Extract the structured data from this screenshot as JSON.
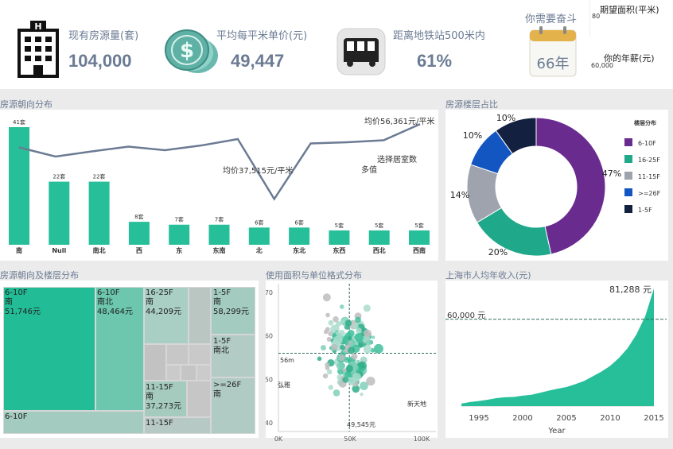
{
  "kpis": {
    "stock_label": "现有房源量(套)",
    "stock_value": "104,000",
    "price_label": "平均每平米单价(元)",
    "price_value": "49,447",
    "metro_label": "距离地铁站500米内",
    "metro_value": "61%",
    "work_label": "你需要奋斗",
    "work_value": "66年",
    "desired_area_label": "期望面积(平米)",
    "desired_area_value": "80",
    "salary_label": "你的年薪(元)",
    "salary_value": "60,000"
  },
  "colors": {
    "teal": "#26bf99",
    "line": "#6b7b93",
    "purple": "#6a2b8f",
    "green2": "#1fa88a",
    "gray": "#9ea3ad",
    "blue": "#1356c2",
    "navy": "#14203f"
  },
  "orientation": {
    "title": "房源朝向分布",
    "annot_high": "均价56,361元/平米",
    "annot_low": "均价37,515元/平米",
    "annot_mid1": "选择居室数",
    "annot_mid2": "多值"
  },
  "floor": {
    "title": "房源楼层占比",
    "legend_title": "楼层分布"
  },
  "treemap": {
    "title": "房源朝向及楼层分布",
    "cells": [
      {
        "floor": "6-10F",
        "dir": "南",
        "price": "51,746元"
      },
      {
        "floor": "6-10F",
        "dir": "南北",
        "price": "48,464元"
      },
      {
        "floor": "16-25F",
        "dir": "南",
        "price": "44,209元"
      },
      {
        "floor": "1-5F",
        "dir": "南",
        "price": "58,299元"
      },
      {
        "floor": "1-5F",
        "dir": "南北",
        "price": ""
      },
      {
        "floor": "11-15F",
        "dir": "南",
        "price": "37,273元"
      },
      {
        "floor": ">=26F",
        "dir": "南",
        "price": ""
      },
      {
        "floor": "6-10F",
        "dir": "",
        "price": ""
      },
      {
        "floor": "11-15F",
        "dir": "",
        "price": ""
      }
    ]
  },
  "scatter": {
    "title": "使用面积与单位格式分布",
    "ref_y_label": "56m",
    "ref_x_label": "49,545元",
    "point_label_left": "弘雅",
    "point_label_right": "新天地"
  },
  "income": {
    "title": "上海市人均年收入(元)",
    "ref_label": "60,000 元",
    "peak_label": "81,288 元"
  },
  "chart_data": [
    {
      "type": "bar",
      "categories": [
        "南",
        "Null",
        "南北",
        "西",
        "东",
        "东南",
        "北",
        "东北",
        "东西",
        "西北",
        "西南"
      ],
      "values": [
        41,
        22,
        22,
        8,
        7,
        7,
        6,
        6,
        5,
        5,
        5
      ],
      "data_labels": [
        "41套",
        "22套",
        "22套",
        "8套",
        "7套",
        "7套",
        "6套",
        "6套",
        "5套",
        "5套",
        "5套"
      ],
      "line_series": {
        "values": [
          50500,
          48200,
          49500,
          50700,
          49800,
          51000,
          52600,
          37515,
          51500,
          51800,
          52300,
          56361
        ]
      },
      "ylim": [
        0,
        41
      ]
    },
    {
      "type": "pie",
      "categories": [
        "6-10F",
        "16-25F",
        "11-15F",
        ">=26F",
        "1-5F"
      ],
      "values": [
        47,
        20,
        14,
        10,
        10
      ],
      "labels": [
        "47%",
        "20%",
        "14%",
        "10%",
        "10%"
      ]
    },
    {
      "type": "table",
      "treemap": true,
      "categories": [
        "6-10F 南",
        "6-10F 南北",
        "16-25F 南",
        "1-5F 南",
        "1-5F 南北",
        "11-15F 南",
        ">=26F 南",
        "6-10F",
        "11-15F"
      ],
      "values": [
        51746,
        48464,
        44209,
        58299,
        null,
        37273,
        null,
        null,
        null
      ]
    },
    {
      "type": "scatter",
      "xlim": [
        0,
        110000
      ],
      "ylim": [
        38,
        72
      ],
      "x_ticks": [
        "0K",
        "50K",
        "100K"
      ],
      "y_ticks": [
        "40",
        "50",
        "60",
        "70"
      ],
      "ref_x": 49545,
      "ref_y": 56
    },
    {
      "type": "area",
      "x": [
        1993,
        1994,
        1995,
        1996,
        1997,
        1998,
        1999,
        2000,
        2001,
        2002,
        2003,
        2004,
        2005,
        2006,
        2007,
        2008,
        2009,
        2010,
        2011,
        2012,
        2013,
        2014,
        2015
      ],
      "values": [
        1700,
        2800,
        3500,
        4400,
        5500,
        6100,
        6300,
        7200,
        7800,
        9200,
        10700,
        12000,
        13200,
        15100,
        17300,
        20500,
        23800,
        27800,
        33200,
        40000,
        49500,
        62000,
        81288
      ],
      "xlabel": "Year",
      "x_ticks": [
        "1995",
        "2000",
        "2005",
        "2010",
        "2015"
      ],
      "ref_y": 60000,
      "ylim": [
        0,
        81288
      ]
    }
  ]
}
